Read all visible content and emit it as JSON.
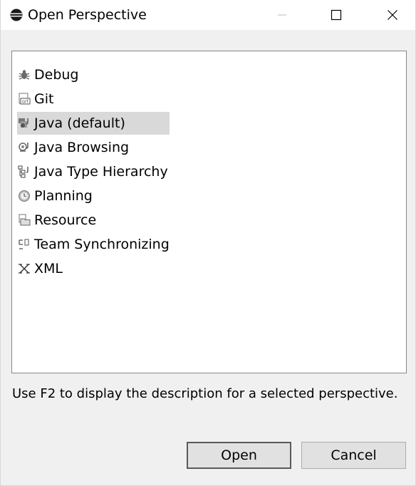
{
  "window": {
    "title": "Open Perspective",
    "buttons": [
      "minimize-icon",
      "maximize-icon",
      "close-icon"
    ]
  },
  "perspectives": [
    {
      "label": "Debug",
      "icon": "debug-bug-icon"
    },
    {
      "label": "Git",
      "icon": "git-icon"
    },
    {
      "label": "Java (default)",
      "icon": "java-perspective-icon",
      "selected": true
    },
    {
      "label": "Java Browsing",
      "icon": "java-browsing-icon"
    },
    {
      "label": "Java Type Hierarchy",
      "icon": "type-hierarchy-icon"
    },
    {
      "label": "Planning",
      "icon": "planning-clock-icon"
    },
    {
      "label": "Resource",
      "icon": "resource-folder-icon"
    },
    {
      "label": "Team Synchronizing",
      "icon": "team-sync-icon"
    },
    {
      "label": "XML",
      "icon": "xml-icon"
    }
  ],
  "description": "Use F2 to display the description for a selected perspective.",
  "actions": {
    "open_label": "Open",
    "cancel_label": "Cancel"
  },
  "colors": {
    "selection": "#d9d9d9",
    "dialog_bg": "#f0f0f0",
    "list_border": "#828790"
  }
}
